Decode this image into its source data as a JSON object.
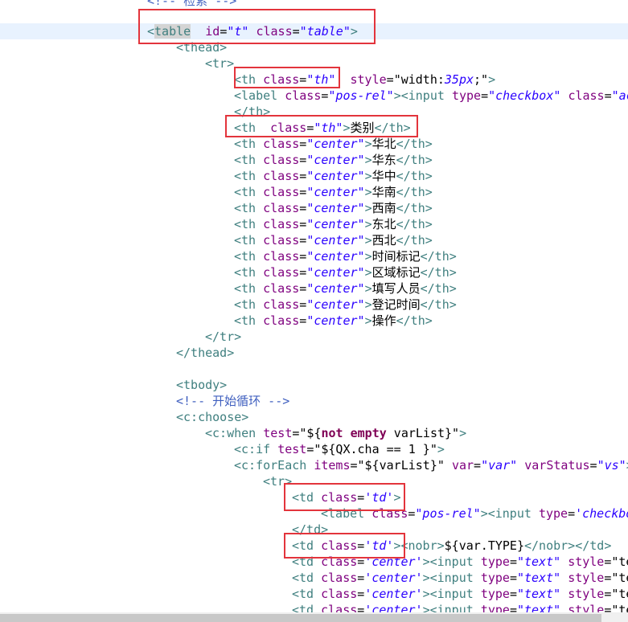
{
  "lines": [
    [
      {
        "t": "<!-- ",
        "c": "cmt"
      },
      {
        "t": "检索",
        "c": "cmt"
      },
      {
        "t": " -->",
        "c": "cmt"
      }
    ],
    [],
    [
      {
        "t": "<",
        "c": "tag"
      },
      {
        "t": "table",
        "c": "tag hl-table"
      },
      {
        "t": "  ",
        "c": "str"
      },
      {
        "t": "id",
        "c": "attr"
      },
      {
        "t": "=",
        "c": "str"
      },
      {
        "t": "\"",
        "c": "val"
      },
      {
        "t": "t\"",
        "c": "val"
      },
      {
        "t": " ",
        "c": "str"
      },
      {
        "t": "class",
        "c": "attr"
      },
      {
        "t": "=",
        "c": "str"
      },
      {
        "t": "\"table\"",
        "c": "val"
      },
      {
        "t": ">",
        "c": "tag"
      }
    ],
    [
      {
        "t": "<thead>",
        "c": "tag"
      }
    ],
    [
      {
        "t": "<tr>",
        "c": "tag"
      }
    ],
    [
      {
        "t": "<th",
        "c": "tag"
      },
      {
        "t": " ",
        "c": "str"
      },
      {
        "t": "class",
        "c": "attr"
      },
      {
        "t": "=",
        "c": "str"
      },
      {
        "t": "\"th\"",
        "c": "val"
      },
      {
        "t": "  ",
        "c": "str"
      },
      {
        "t": "style",
        "c": "attr"
      },
      {
        "t": "=",
        "c": "str"
      },
      {
        "t": "\"width:",
        "c": "str"
      },
      {
        "t": "35px",
        "c": "val"
      },
      {
        "t": ";\"",
        "c": "str"
      },
      {
        "t": ">",
        "c": "tag"
      }
    ],
    [
      {
        "t": "<label",
        "c": "tag"
      },
      {
        "t": " ",
        "c": "str"
      },
      {
        "t": "class",
        "c": "attr"
      },
      {
        "t": "=",
        "c": "str"
      },
      {
        "t": "\"pos-rel\"",
        "c": "val"
      },
      {
        "t": "><input",
        "c": "tag"
      },
      {
        "t": " ",
        "c": "str"
      },
      {
        "t": "type",
        "c": "attr"
      },
      {
        "t": "=",
        "c": "str"
      },
      {
        "t": "\"checkbox\"",
        "c": "val"
      },
      {
        "t": " ",
        "c": "str"
      },
      {
        "t": "class",
        "c": "attr"
      },
      {
        "t": "=",
        "c": "str"
      },
      {
        "t": "\"ace\"",
        "c": "val"
      }
    ],
    [
      {
        "t": "</th>",
        "c": "tag"
      }
    ],
    [
      {
        "t": "<th",
        "c": "tag"
      },
      {
        "t": "  ",
        "c": "str"
      },
      {
        "t": "class",
        "c": "attr"
      },
      {
        "t": "=",
        "c": "str"
      },
      {
        "t": "\"th\"",
        "c": "val"
      },
      {
        "t": ">",
        "c": "tag"
      },
      {
        "t": "类别",
        "c": "str"
      },
      {
        "t": "</th>",
        "c": "tag"
      }
    ],
    [
      {
        "t": "<th",
        "c": "tag"
      },
      {
        "t": " ",
        "c": "str"
      },
      {
        "t": "class",
        "c": "attr"
      },
      {
        "t": "=",
        "c": "str"
      },
      {
        "t": "\"center\"",
        "c": "val"
      },
      {
        "t": ">",
        "c": "tag"
      },
      {
        "t": "华北",
        "c": "str"
      },
      {
        "t": "</th>",
        "c": "tag"
      }
    ],
    [
      {
        "t": "<th",
        "c": "tag"
      },
      {
        "t": " ",
        "c": "str"
      },
      {
        "t": "class",
        "c": "attr"
      },
      {
        "t": "=",
        "c": "str"
      },
      {
        "t": "\"center\"",
        "c": "val"
      },
      {
        "t": ">",
        "c": "tag"
      },
      {
        "t": "华东",
        "c": "str"
      },
      {
        "t": "</th>",
        "c": "tag"
      }
    ],
    [
      {
        "t": "<th",
        "c": "tag"
      },
      {
        "t": " ",
        "c": "str"
      },
      {
        "t": "class",
        "c": "attr"
      },
      {
        "t": "=",
        "c": "str"
      },
      {
        "t": "\"center\"",
        "c": "val"
      },
      {
        "t": ">",
        "c": "tag"
      },
      {
        "t": "华中",
        "c": "str"
      },
      {
        "t": "</th>",
        "c": "tag"
      }
    ],
    [
      {
        "t": "<th",
        "c": "tag"
      },
      {
        "t": " ",
        "c": "str"
      },
      {
        "t": "class",
        "c": "attr"
      },
      {
        "t": "=",
        "c": "str"
      },
      {
        "t": "\"center\"",
        "c": "val"
      },
      {
        "t": ">",
        "c": "tag"
      },
      {
        "t": "华南",
        "c": "str"
      },
      {
        "t": "</th>",
        "c": "tag"
      }
    ],
    [
      {
        "t": "<th",
        "c": "tag"
      },
      {
        "t": " ",
        "c": "str"
      },
      {
        "t": "class",
        "c": "attr"
      },
      {
        "t": "=",
        "c": "str"
      },
      {
        "t": "\"center\"",
        "c": "val"
      },
      {
        "t": ">",
        "c": "tag"
      },
      {
        "t": "西南",
        "c": "str"
      },
      {
        "t": "</th>",
        "c": "tag"
      }
    ],
    [
      {
        "t": "<th",
        "c": "tag"
      },
      {
        "t": " ",
        "c": "str"
      },
      {
        "t": "class",
        "c": "attr"
      },
      {
        "t": "=",
        "c": "str"
      },
      {
        "t": "\"center\"",
        "c": "val"
      },
      {
        "t": ">",
        "c": "tag"
      },
      {
        "t": "东北",
        "c": "str"
      },
      {
        "t": "</th>",
        "c": "tag"
      }
    ],
    [
      {
        "t": "<th",
        "c": "tag"
      },
      {
        "t": " ",
        "c": "str"
      },
      {
        "t": "class",
        "c": "attr"
      },
      {
        "t": "=",
        "c": "str"
      },
      {
        "t": "\"center\"",
        "c": "val"
      },
      {
        "t": ">",
        "c": "tag"
      },
      {
        "t": "西北",
        "c": "str"
      },
      {
        "t": "</th>",
        "c": "tag"
      }
    ],
    [
      {
        "t": "<th",
        "c": "tag"
      },
      {
        "t": " ",
        "c": "str"
      },
      {
        "t": "class",
        "c": "attr"
      },
      {
        "t": "=",
        "c": "str"
      },
      {
        "t": "\"center\"",
        "c": "val"
      },
      {
        "t": ">",
        "c": "tag"
      },
      {
        "t": "时间标记",
        "c": "str"
      },
      {
        "t": "</th>",
        "c": "tag"
      }
    ],
    [
      {
        "t": "<th",
        "c": "tag"
      },
      {
        "t": " ",
        "c": "str"
      },
      {
        "t": "class",
        "c": "attr"
      },
      {
        "t": "=",
        "c": "str"
      },
      {
        "t": "\"center\"",
        "c": "val"
      },
      {
        "t": ">",
        "c": "tag"
      },
      {
        "t": "区域标记",
        "c": "str"
      },
      {
        "t": "</th>",
        "c": "tag"
      }
    ],
    [
      {
        "t": "<th",
        "c": "tag"
      },
      {
        "t": " ",
        "c": "str"
      },
      {
        "t": "class",
        "c": "attr"
      },
      {
        "t": "=",
        "c": "str"
      },
      {
        "t": "\"center\"",
        "c": "val"
      },
      {
        "t": ">",
        "c": "tag"
      },
      {
        "t": "填写人员",
        "c": "str"
      },
      {
        "t": "</th>",
        "c": "tag"
      }
    ],
    [
      {
        "t": "<th",
        "c": "tag"
      },
      {
        "t": " ",
        "c": "str"
      },
      {
        "t": "class",
        "c": "attr"
      },
      {
        "t": "=",
        "c": "str"
      },
      {
        "t": "\"center\"",
        "c": "val"
      },
      {
        "t": ">",
        "c": "tag"
      },
      {
        "t": "登记时间",
        "c": "str"
      },
      {
        "t": "</th>",
        "c": "tag"
      }
    ],
    [
      {
        "t": "<th",
        "c": "tag"
      },
      {
        "t": " ",
        "c": "str"
      },
      {
        "t": "class",
        "c": "attr"
      },
      {
        "t": "=",
        "c": "str"
      },
      {
        "t": "\"center\"",
        "c": "val"
      },
      {
        "t": ">",
        "c": "tag"
      },
      {
        "t": "操作",
        "c": "str"
      },
      {
        "t": "</th>",
        "c": "tag"
      }
    ],
    [
      {
        "t": "</tr>",
        "c": "tag"
      }
    ],
    [
      {
        "t": "</thead>",
        "c": "tag"
      }
    ],
    [],
    [
      {
        "t": "<tbody>",
        "c": "tag"
      }
    ],
    [
      {
        "t": "<!-- 开始循环 -->",
        "c": "cmt"
      }
    ],
    [
      {
        "t": "<c:choose>",
        "c": "tag"
      }
    ],
    [
      {
        "t": "<c:when",
        "c": "tag"
      },
      {
        "t": " ",
        "c": "str"
      },
      {
        "t": "test",
        "c": "attr"
      },
      {
        "t": "=",
        "c": "str"
      },
      {
        "t": "\"${",
        "c": "str"
      },
      {
        "t": "not",
        "c": "kw"
      },
      {
        "t": " ",
        "c": "str"
      },
      {
        "t": "empty",
        "c": "kw"
      },
      {
        "t": " varList}\"",
        "c": "str"
      },
      {
        "t": ">",
        "c": "tag"
      }
    ],
    [
      {
        "t": "<c:if",
        "c": "tag"
      },
      {
        "t": " ",
        "c": "str"
      },
      {
        "t": "test",
        "c": "attr"
      },
      {
        "t": "=",
        "c": "str"
      },
      {
        "t": "\"${QX.cha == 1 }\"",
        "c": "str"
      },
      {
        "t": ">",
        "c": "tag"
      }
    ],
    [
      {
        "t": "<c:forEach",
        "c": "tag"
      },
      {
        "t": " ",
        "c": "str"
      },
      {
        "t": "items",
        "c": "attr"
      },
      {
        "t": "=",
        "c": "str"
      },
      {
        "t": "\"${varList}\"",
        "c": "str"
      },
      {
        "t": " ",
        "c": "str"
      },
      {
        "t": "var",
        "c": "attr"
      },
      {
        "t": "=",
        "c": "str"
      },
      {
        "t": "\"var\"",
        "c": "val"
      },
      {
        "t": " ",
        "c": "str"
      },
      {
        "t": "varStatus",
        "c": "attr"
      },
      {
        "t": "=",
        "c": "str"
      },
      {
        "t": "\"vs\"",
        "c": "val"
      },
      {
        "t": ">",
        "c": "tag"
      }
    ],
    [
      {
        "t": "<tr>",
        "c": "tag"
      }
    ],
    [
      {
        "t": "<td",
        "c": "tag"
      },
      {
        "t": " ",
        "c": "str"
      },
      {
        "t": "class",
        "c": "attr"
      },
      {
        "t": "=",
        "c": "str"
      },
      {
        "t": "'td'",
        "c": "val"
      },
      {
        "t": ">",
        "c": "tag"
      }
    ],
    [
      {
        "t": "<label",
        "c": "tag"
      },
      {
        "t": " ",
        "c": "str"
      },
      {
        "t": "class",
        "c": "attr"
      },
      {
        "t": "=",
        "c": "str"
      },
      {
        "t": "\"pos-rel\"",
        "c": "val"
      },
      {
        "t": "><input",
        "c": "tag"
      },
      {
        "t": " ",
        "c": "str"
      },
      {
        "t": "type",
        "c": "attr"
      },
      {
        "t": "=",
        "c": "str"
      },
      {
        "t": "'checkbox'",
        "c": "val"
      }
    ],
    [
      {
        "t": "</td>",
        "c": "tag"
      }
    ],
    [
      {
        "t": "<td",
        "c": "tag"
      },
      {
        "t": " ",
        "c": "str"
      },
      {
        "t": "class",
        "c": "attr"
      },
      {
        "t": "=",
        "c": "str"
      },
      {
        "t": "'td'",
        "c": "val"
      },
      {
        "t": "><nobr>",
        "c": "tag"
      },
      {
        "t": "${var.TYPE}",
        "c": "str"
      },
      {
        "t": "</nobr></td>",
        "c": "tag"
      }
    ],
    [
      {
        "t": "<td",
        "c": "tag"
      },
      {
        "t": " ",
        "c": "str"
      },
      {
        "t": "class",
        "c": "attr"
      },
      {
        "t": "=",
        "c": "str"
      },
      {
        "t": "'center'",
        "c": "val"
      },
      {
        "t": "><input",
        "c": "tag"
      },
      {
        "t": " ",
        "c": "str"
      },
      {
        "t": "type",
        "c": "attr"
      },
      {
        "t": "=",
        "c": "str"
      },
      {
        "t": "\"text\"",
        "c": "val"
      },
      {
        "t": " ",
        "c": "str"
      },
      {
        "t": "style",
        "c": "attr"
      },
      {
        "t": "=",
        "c": "str"
      },
      {
        "t": "\"text",
        "c": "str"
      }
    ],
    [
      {
        "t": "<td",
        "c": "tag"
      },
      {
        "t": " ",
        "c": "str"
      },
      {
        "t": "class",
        "c": "attr"
      },
      {
        "t": "=",
        "c": "str"
      },
      {
        "t": "'center'",
        "c": "val"
      },
      {
        "t": "><input",
        "c": "tag"
      },
      {
        "t": " ",
        "c": "str"
      },
      {
        "t": "type",
        "c": "attr"
      },
      {
        "t": "=",
        "c": "str"
      },
      {
        "t": "\"text\"",
        "c": "val"
      },
      {
        "t": " ",
        "c": "str"
      },
      {
        "t": "style",
        "c": "attr"
      },
      {
        "t": "=",
        "c": "str"
      },
      {
        "t": "\"text",
        "c": "str"
      }
    ],
    [
      {
        "t": "<td",
        "c": "tag"
      },
      {
        "t": " ",
        "c": "str"
      },
      {
        "t": "class",
        "c": "attr"
      },
      {
        "t": "=",
        "c": "str"
      },
      {
        "t": "'center'",
        "c": "val"
      },
      {
        "t": "><input",
        "c": "tag"
      },
      {
        "t": " ",
        "c": "str"
      },
      {
        "t": "type",
        "c": "attr"
      },
      {
        "t": "=",
        "c": "str"
      },
      {
        "t": "\"text\"",
        "c": "val"
      },
      {
        "t": " ",
        "c": "str"
      },
      {
        "t": "style",
        "c": "attr"
      },
      {
        "t": "=",
        "c": "str"
      },
      {
        "t": "\"text",
        "c": "str"
      }
    ],
    [
      {
        "t": "<td",
        "c": "tag"
      },
      {
        "t": " ",
        "c": "str"
      },
      {
        "t": "class",
        "c": "attr"
      },
      {
        "t": "=",
        "c": "str"
      },
      {
        "t": "'center'",
        "c": "val"
      },
      {
        "t": "><input",
        "c": "tag"
      },
      {
        "t": " ",
        "c": "str"
      },
      {
        "t": "type",
        "c": "attr"
      },
      {
        "t": "=",
        "c": "str"
      },
      {
        "t": "\"text\"",
        "c": "val"
      },
      {
        "t": " ",
        "c": "str"
      },
      {
        "t": "style",
        "c": "attr"
      },
      {
        "t": "=",
        "c": "str"
      },
      {
        "t": "\"text",
        "c": "str"
      }
    ]
  ],
  "colors": {
    "tag": "#3f7f7f",
    "attribute": "#7f007f",
    "value": "#2a00ff",
    "comment": "#3f5fbf",
    "keyword": "#7f0055",
    "annotation_box": "#e3343c",
    "current_line": "#e8f2fe"
  }
}
